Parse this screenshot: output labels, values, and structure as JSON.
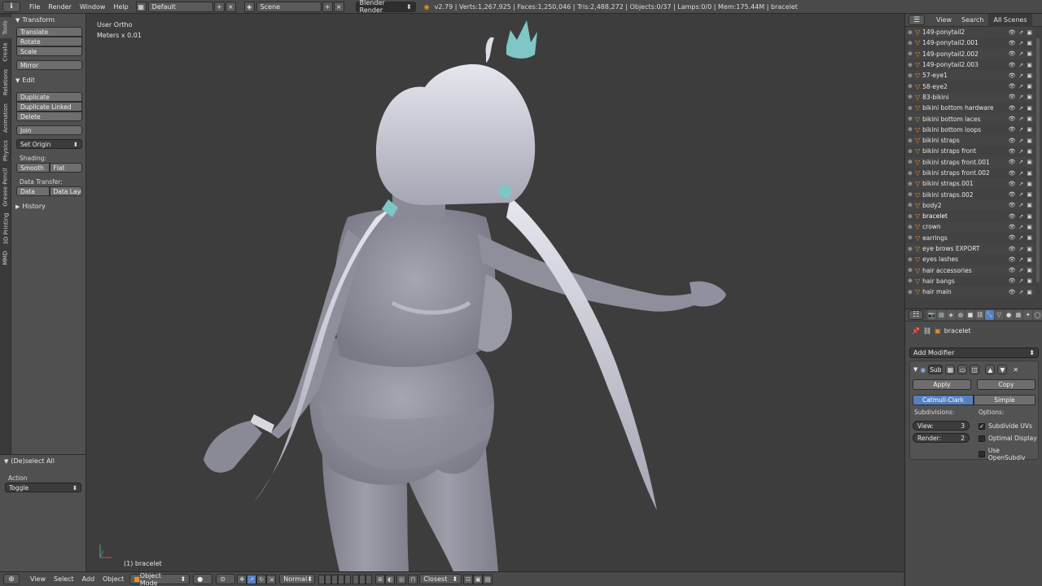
{
  "topbar": {
    "menus": [
      "File",
      "Render",
      "Window",
      "Help"
    ],
    "layout": "Default",
    "scene": "Scene",
    "engine": "Blender Render",
    "stats": "v2.79 | Verts:1,267,925 | Faces:1,250,046 | Tris:2,488,272 | Objects:0/37 | Lamps:0/0 | Mem:175.44M | bracelet"
  },
  "left_tabs": [
    "Tools",
    "Create",
    "Relations",
    "Animation",
    "Physics",
    "Grease Pencil",
    "3D Printing",
    "MMD"
  ],
  "toolshelf": {
    "transform_title": "Transform",
    "translate": "Translate",
    "rotate": "Rotate",
    "scale": "Scale",
    "mirror": "Mirror",
    "edit_title": "Edit",
    "duplicate": "Duplicate",
    "duplicate_linked": "Duplicate Linked",
    "delete": "Delete",
    "join": "Join",
    "set_origin": "Set Origin",
    "shading_label": "Shading:",
    "smooth": "Smooth",
    "flat": "Flat",
    "data_transfer_label": "Data Transfer:",
    "data": "Data",
    "data_layout": "Data Layo",
    "history_title": "History"
  },
  "operator_panel": {
    "title": "(De)select All",
    "action_label": "Action",
    "action_value": "Toggle"
  },
  "viewport": {
    "view_name": "User Ortho",
    "units": "Meters x 0.01",
    "object_label": "(1) bracelet"
  },
  "bottombar": {
    "view": "View",
    "select": "Select",
    "add": "Add",
    "object": "Object",
    "mode": "Object Mode",
    "pivot": "Normal",
    "snap": "Closest"
  },
  "outliner": {
    "tabs": [
      "View",
      "Search",
      "All Scenes"
    ],
    "items": [
      {
        "name": "149-ponytail2",
        "selected": false
      },
      {
        "name": "149-ponytail2.001",
        "selected": false
      },
      {
        "name": "149-ponytail2.002",
        "selected": false
      },
      {
        "name": "149-ponytail2.003",
        "selected": false
      },
      {
        "name": "57-eye1",
        "selected": false
      },
      {
        "name": "58-eye2",
        "selected": false
      },
      {
        "name": "83-bikini",
        "selected": false
      },
      {
        "name": "bikini bottom hardware",
        "selected": false
      },
      {
        "name": "bikini bottom laces",
        "selected": false
      },
      {
        "name": "bikini bottom loops",
        "selected": false
      },
      {
        "name": "bikini straps",
        "selected": false
      },
      {
        "name": "bikini straps front",
        "selected": false
      },
      {
        "name": "bikini straps front.001",
        "selected": false
      },
      {
        "name": "bikini straps front.002",
        "selected": false
      },
      {
        "name": "bikini straps.001",
        "selected": false
      },
      {
        "name": "bikini straps.002",
        "selected": false
      },
      {
        "name": "body2",
        "selected": false
      },
      {
        "name": "bracelet",
        "selected": true
      },
      {
        "name": "crown",
        "selected": false
      },
      {
        "name": "earrings",
        "selected": false
      },
      {
        "name": "eye brows EXPORT",
        "selected": false
      },
      {
        "name": "eyes lashes",
        "selected": false
      },
      {
        "name": "hair accessories",
        "selected": false
      },
      {
        "name": "hair bangs",
        "selected": false
      },
      {
        "name": "hair main",
        "selected": false
      }
    ]
  },
  "properties": {
    "object_name": "bracelet",
    "add_modifier": "Add Modifier",
    "modifier_name": "Sub",
    "apply": "Apply",
    "copy": "Copy",
    "catmull": "Catmull-Clark",
    "simple": "Simple",
    "subdivisions_label": "Subdivisions:",
    "options_label": "Options:",
    "view_label": "View:",
    "view_value": "3",
    "render_label": "Render:",
    "render_value": "2",
    "subdivide_uvs": "Subdivide UVs",
    "optimal_display": "Optimal Display",
    "use_opensubdiv": "Use OpenSubdiv",
    "subdivide_uvs_checked": true,
    "optimal_display_checked": false,
    "use_opensubdiv_checked": false
  },
  "colors": {
    "accent": "#5680c2",
    "crown": "#7fc6c6",
    "mesh": "#9a9aa6",
    "hair": "#c8c8d4"
  }
}
